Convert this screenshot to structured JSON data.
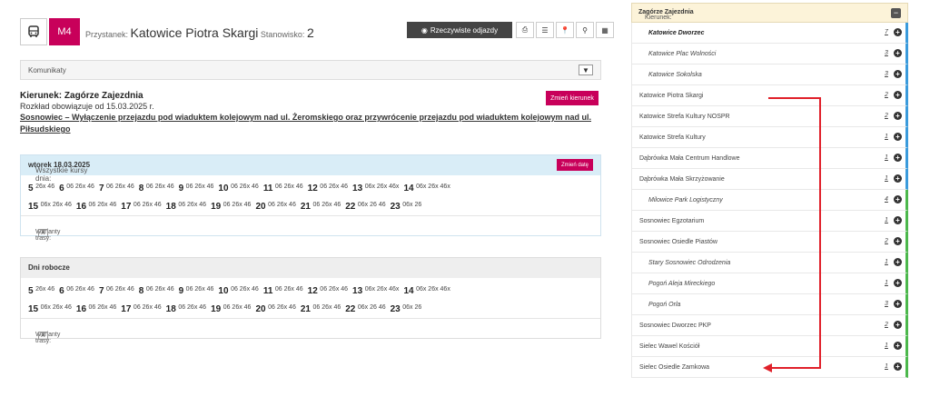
{
  "topbar": {
    "line": "M4",
    "stop_label": "Przystanek:",
    "stop_name": "Katowice Piotra Skargi",
    "platform_label": "Stanowisko:",
    "platform": "2",
    "realtime_button": "Rzeczywiste odjazdy",
    "tool_icons": [
      "print-icon",
      "list-icon",
      "pin-icon",
      "map-marker-icon",
      "qr-icon"
    ]
  },
  "komunikaty": {
    "label": "Komunikaty"
  },
  "direction": {
    "heading": "Kierunek: Zagórze Zajezdnia",
    "valid_from": "Rozkład obowiązuje od 15.03.2025 r.",
    "notice": "Sosnowiec – Wyłączenie przejazdu pod wiaduktem kolejowym nad ul. Żeromskiego oraz przywrócenie przejazdu pod wiaduktem kolejowym nad ul. Piłsudskiego",
    "change_direction_button": "Zmień kierunek"
  },
  "schedule_all": {
    "header_prefix": "Wszystkie kursy dnia:",
    "header_date": "wtorek 18.03.2025",
    "change_date_button": "Zmień datę",
    "variants_label": "Warianty trasy:",
    "variant_x": "X",
    "rows": [
      [
        [
          "5",
          "26x 46"
        ],
        [
          "6",
          "06 26x 46"
        ],
        [
          "7",
          "06 26x 46"
        ],
        [
          "8",
          "06 26x 46"
        ],
        [
          "9",
          "06 26x 46"
        ],
        [
          "10",
          "06 26x 46"
        ],
        [
          "11",
          "06 26x 46"
        ],
        [
          "12",
          "06 26x 46"
        ],
        [
          "13",
          "06x 26x 46x"
        ],
        [
          "14",
          "06x 26x 46x"
        ]
      ],
      [
        [
          "15",
          "06x 26x 46"
        ],
        [
          "16",
          "06 26x 46"
        ],
        [
          "17",
          "06 26x 46"
        ],
        [
          "18",
          "06 26x 46"
        ],
        [
          "19",
          "06 26x 46"
        ],
        [
          "20",
          "06 26x 46"
        ],
        [
          "21",
          "06 26x 46"
        ],
        [
          "22",
          "06x 26 46"
        ],
        [
          "23",
          "06x 26"
        ]
      ]
    ]
  },
  "schedule_weekdays": {
    "header": "Dni robocze",
    "variants_label": "Warianty trasy:",
    "variant_x": "X",
    "rows": [
      [
        [
          "5",
          "26x 46"
        ],
        [
          "6",
          "06 26x 46"
        ],
        [
          "7",
          "06 26x 46"
        ],
        [
          "8",
          "06 26x 46"
        ],
        [
          "9",
          "06 26x 46"
        ],
        [
          "10",
          "06 26x 46"
        ],
        [
          "11",
          "06 26x 46"
        ],
        [
          "12",
          "06 26x 46"
        ],
        [
          "13",
          "06x 26x 46x"
        ],
        [
          "14",
          "06x 26x 46x"
        ]
      ],
      [
        [
          "15",
          "06x 26x 46"
        ],
        [
          "16",
          "06 26x 46"
        ],
        [
          "17",
          "06 26x 46"
        ],
        [
          "18",
          "06 26x 46"
        ],
        [
          "19",
          "06 26x 46"
        ],
        [
          "20",
          "06 26x 46"
        ],
        [
          "21",
          "06 26x 46"
        ],
        [
          "22",
          "06x 26 46"
        ],
        [
          "23",
          "06x 26"
        ]
      ]
    ]
  },
  "route": {
    "header_prefix": "Kierunek:",
    "header_direction": "Zagórze Zajezdnia",
    "stops": [
      {
        "name": "Katowice Dworzec",
        "no": "7",
        "style": "bold-italic",
        "bar": "blue"
      },
      {
        "name": "Katowice Plac Wolności",
        "no": "3",
        "style": "italic",
        "bar": "blue"
      },
      {
        "name": "Katowice Sokolska",
        "no": "3",
        "style": "italic",
        "bar": "blue"
      },
      {
        "name": "Katowice Piotra Skargi",
        "no": "2",
        "style": "normal",
        "bar": "blue"
      },
      {
        "name": "Katowice Strefa Kultury NOSPR",
        "no": "2",
        "style": "normal",
        "bar": "blue"
      },
      {
        "name": "Katowice Strefa Kultury",
        "no": "1",
        "style": "normal",
        "bar": "blue"
      },
      {
        "name": "Dąbrówka Mała Centrum Handlowe",
        "no": "1",
        "style": "normal",
        "bar": "blue"
      },
      {
        "name": "Dąbrówka Mała Skrzyżowanie",
        "no": "1",
        "style": "normal",
        "bar": "blue"
      },
      {
        "name": "Milowice Park Logistyczny",
        "no": "4",
        "style": "italic",
        "bar": "green"
      },
      {
        "name": "Sosnowiec Egzotarium",
        "no": "1",
        "style": "normal",
        "bar": "green"
      },
      {
        "name": "Sosnowiec Osiedle Piastów",
        "no": "2",
        "style": "normal",
        "bar": "green"
      },
      {
        "name": "Stary Sosnowiec Odrodzenia",
        "no": "1",
        "style": "italic",
        "bar": "green"
      },
      {
        "name": "Pogoń Aleja Mireckiego",
        "no": "1",
        "style": "italic",
        "bar": "green"
      },
      {
        "name": "Pogoń Orla",
        "no": "3",
        "style": "italic",
        "bar": "green"
      },
      {
        "name": "Sosnowiec Dworzec PKP",
        "no": "2",
        "style": "normal",
        "bar": "green"
      },
      {
        "name": "Sielec Wawel Kościół",
        "no": "1",
        "style": "normal",
        "bar": "green"
      },
      {
        "name": "Sielec Osiedle Zamkowa",
        "no": "1",
        "style": "normal",
        "bar": "green"
      }
    ]
  },
  "colors": {
    "accent": "#c8005a",
    "blue_bar": "#3a9bdc",
    "green_bar": "#4cb84c",
    "arrow": "#e0202a"
  }
}
